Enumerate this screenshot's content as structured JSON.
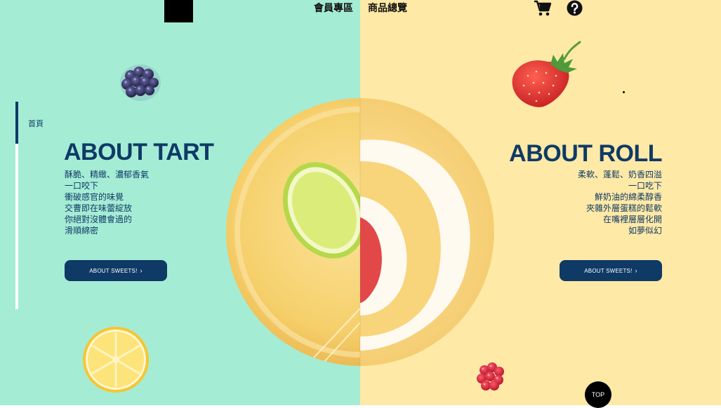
{
  "nav": {
    "member_label": "會員專區",
    "products_label": "商品總覽"
  },
  "sidebar": {
    "breadcrumb": "首頁"
  },
  "left": {
    "heading": "ABOUT TART",
    "lines": [
      "酥脆、精緻、濃郁香氣",
      "一口咬下",
      "衝破感官的味覺",
      "交曹即在味蕾綻放",
      "你絕對沒體會過的",
      "滑順綿密"
    ],
    "cta_label": "ABOUT SWEETS!"
  },
  "right": {
    "heading": "ABOUT ROLL",
    "lines": [
      "柔軟、蓬鬆、奶香四溢",
      "一口吃下",
      "鮮奶油的綿柔醇香",
      "夾雜外層蛋糕的鬆軟",
      "在嘴裡層層化開",
      "如夢似幻"
    ],
    "cta_label": "ABOUT SWEETS!"
  },
  "top_button_label": "TOP",
  "colors": {
    "mint": "#a5ecd5",
    "cream": "#ffe9a6",
    "navy": "#0f3a66"
  },
  "icons": [
    "cart-icon",
    "help-icon",
    "chevron-right-icon"
  ]
}
